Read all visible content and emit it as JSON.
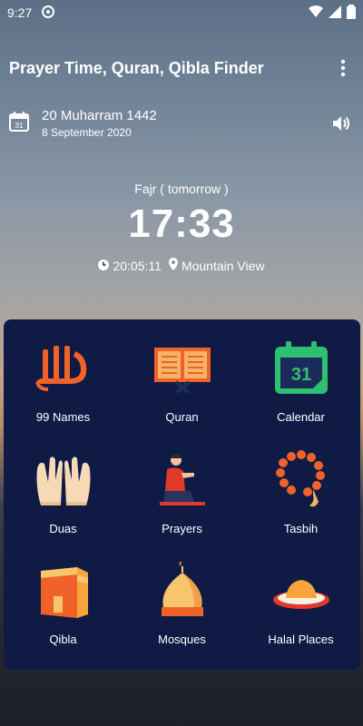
{
  "status_bar": {
    "time": "9:27"
  },
  "app_bar": {
    "title": "Prayer Time, Quran, Qibla Finder"
  },
  "date": {
    "calendar_icon_day": "31",
    "hijri": "20 Muharram 1442",
    "gregorian": "8 September 2020"
  },
  "next_prayer": {
    "label": "Fajr ( tomorrow )",
    "time": "17:33",
    "countdown": "20:05:11",
    "location": "Mountain View"
  },
  "grid": [
    {
      "label": "99 Names",
      "icon": "allah-calligraphy-icon"
    },
    {
      "label": "Quran",
      "icon": "quran-book-icon"
    },
    {
      "label": "Calendar",
      "icon": "calendar-icon",
      "day": "31"
    },
    {
      "label": "Duas",
      "icon": "praying-hands-icon"
    },
    {
      "label": "Prayers",
      "icon": "praying-man-icon"
    },
    {
      "label": "Tasbih",
      "icon": "prayer-beads-icon"
    },
    {
      "label": "Qibla",
      "icon": "kaaba-icon"
    },
    {
      "label": "Mosques",
      "icon": "mosque-dome-icon"
    },
    {
      "label": "Halal Places",
      "icon": "halal-food-icon"
    }
  ],
  "colors": {
    "card_bg": "#0f1a45",
    "accent_orange": "#f0622a",
    "calendar_green": "#2fbf71"
  }
}
